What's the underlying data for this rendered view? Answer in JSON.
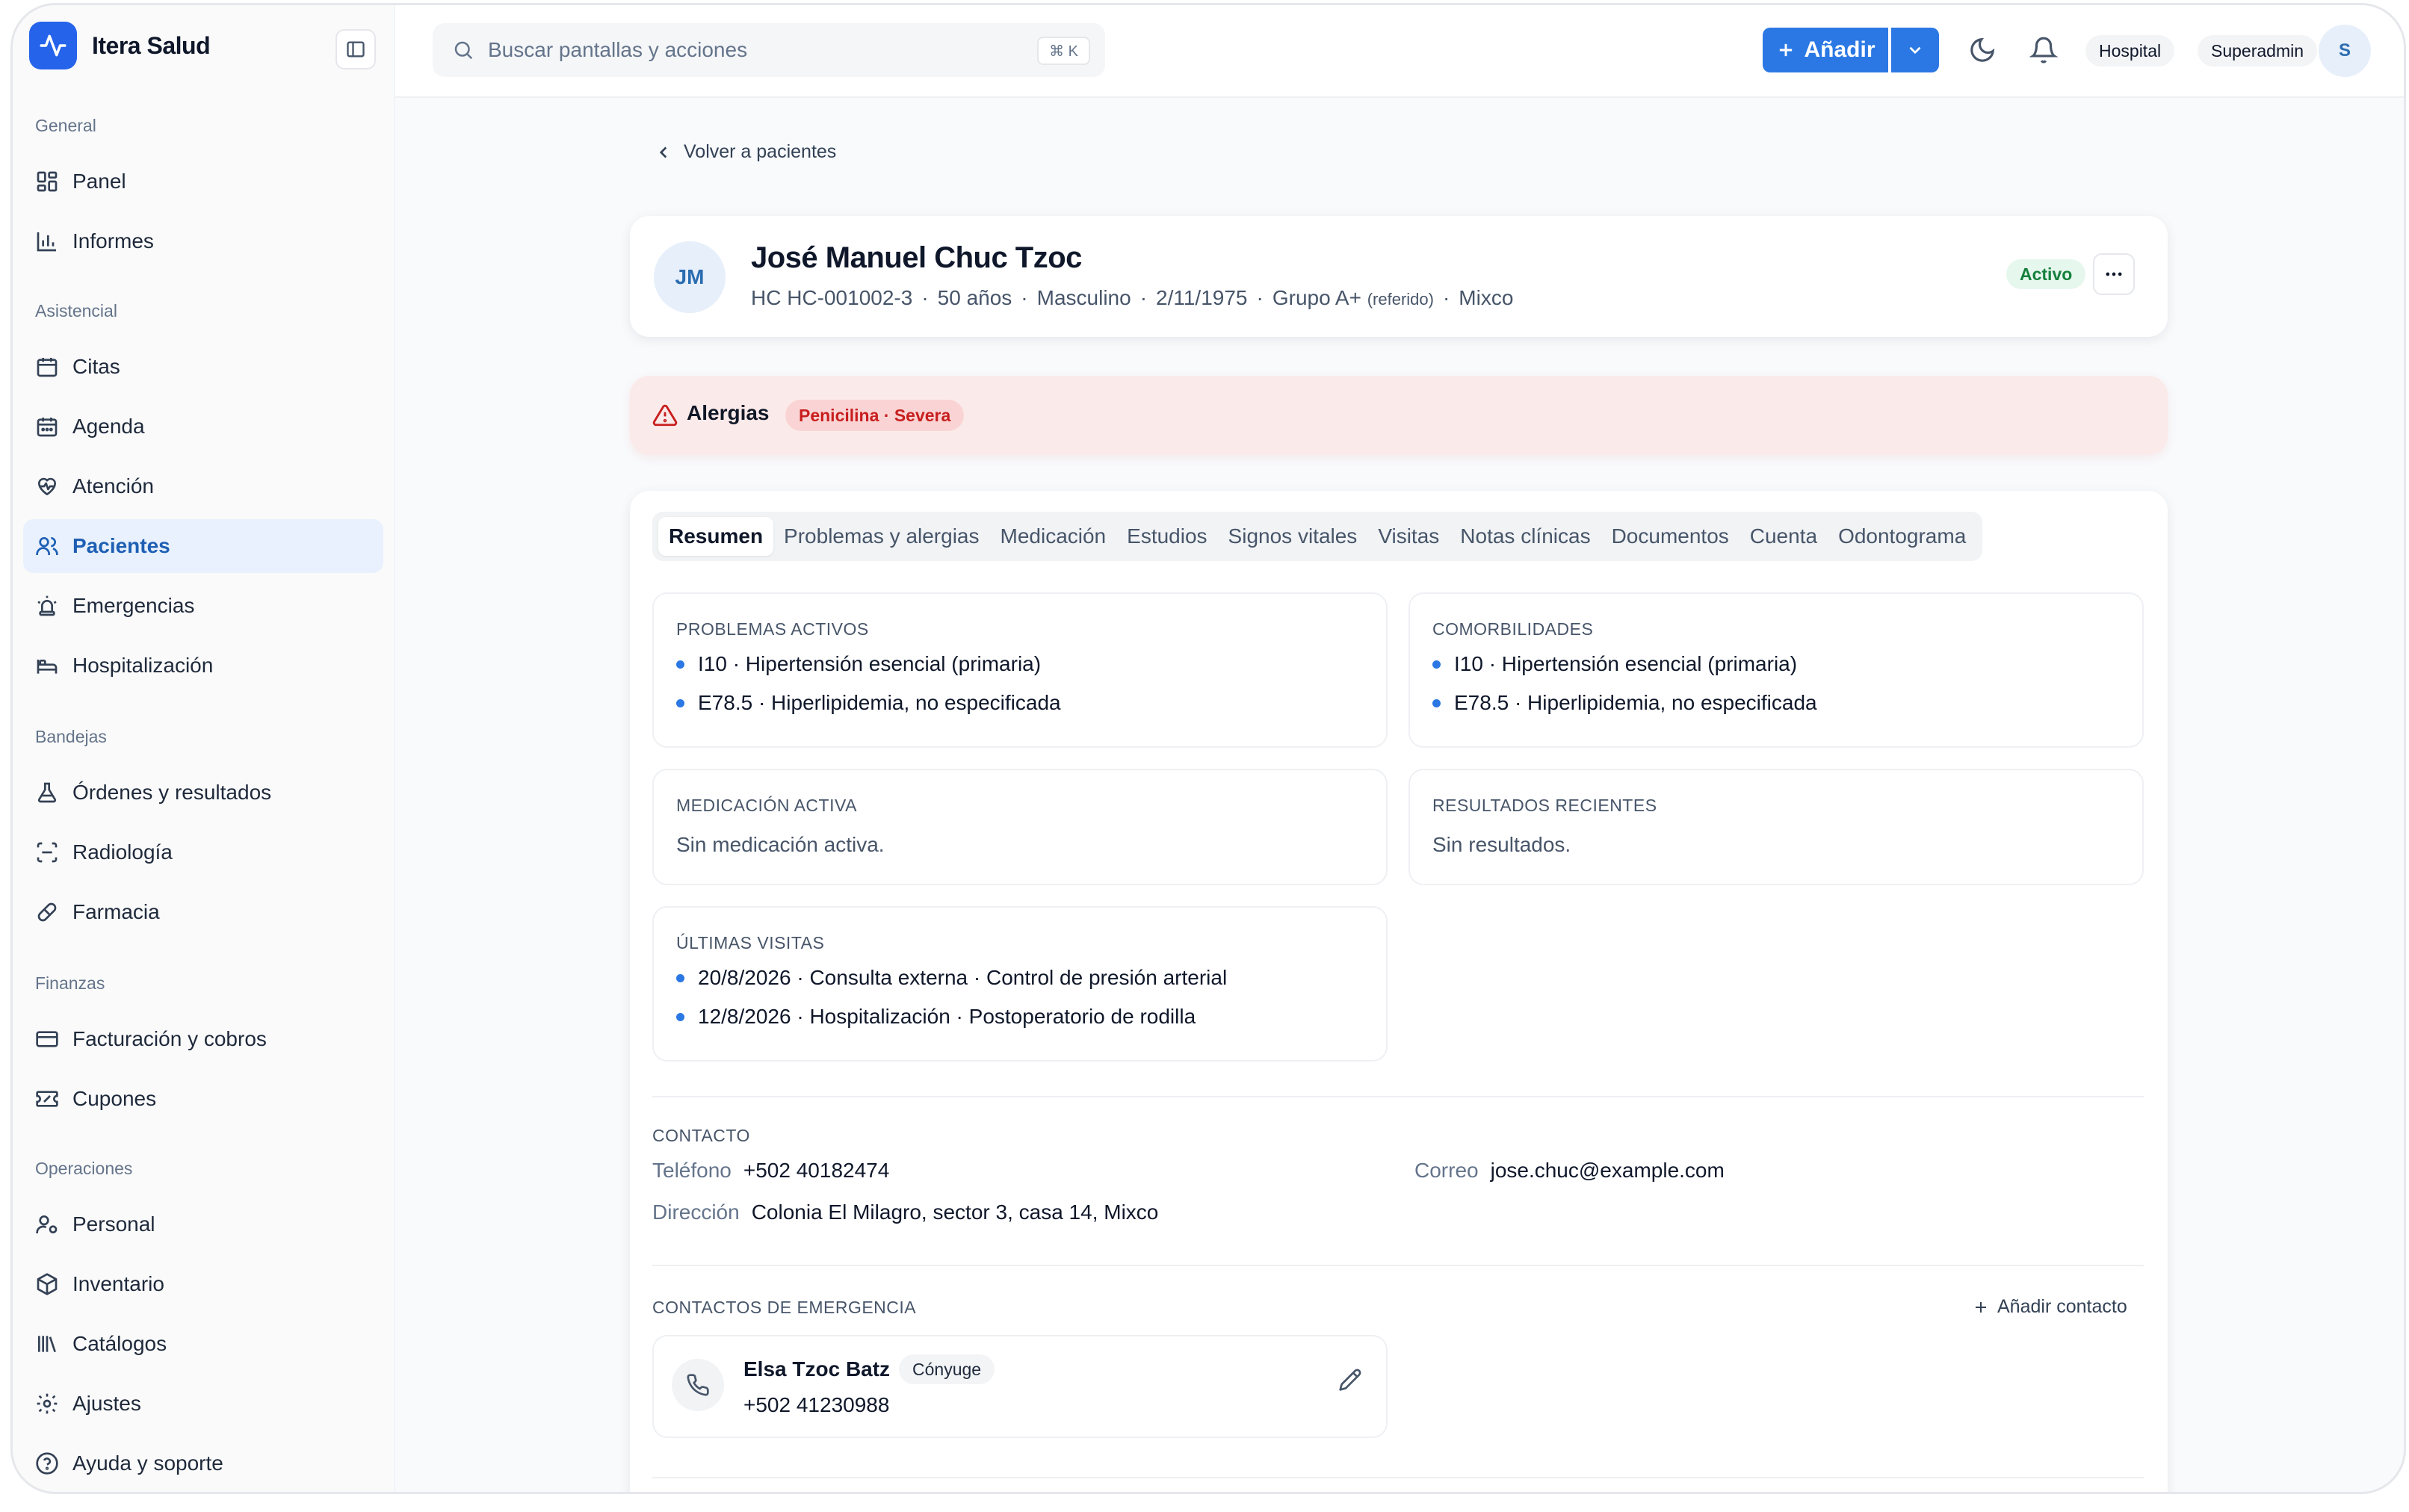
{
  "app": {
    "name": "Itera Salud"
  },
  "sidebar": {
    "sections": [
      {
        "label": "General"
      },
      {
        "label": "Asistencial"
      },
      {
        "label": "Bandejas"
      },
      {
        "label": "Finanzas"
      },
      {
        "label": "Operaciones"
      }
    ],
    "items": [
      {
        "label": "Panel",
        "icon": "grid-icon"
      },
      {
        "label": "Informes",
        "icon": "bar-chart-icon"
      },
      {
        "label": "Citas",
        "icon": "calendar-icon"
      },
      {
        "label": "Agenda",
        "icon": "calendar-grid-icon"
      },
      {
        "label": "Atención",
        "icon": "heart-pulse-icon"
      },
      {
        "label": "Pacientes",
        "icon": "users-icon",
        "active": true
      },
      {
        "label": "Emergencias",
        "icon": "siren-icon"
      },
      {
        "label": "Hospitalización",
        "icon": "bed-icon"
      },
      {
        "label": "Órdenes y resultados",
        "icon": "flask-icon"
      },
      {
        "label": "Radiología",
        "icon": "scan-icon"
      },
      {
        "label": "Farmacia",
        "icon": "pill-icon"
      },
      {
        "label": "Facturación y cobros",
        "icon": "credit-card-icon"
      },
      {
        "label": "Cupones",
        "icon": "ticket-icon"
      },
      {
        "label": "Personal",
        "icon": "user-cog-icon"
      },
      {
        "label": "Inventario",
        "icon": "package-icon"
      },
      {
        "label": "Catálogos",
        "icon": "library-icon"
      },
      {
        "label": "Ajustes",
        "icon": "gear-icon"
      },
      {
        "label": "Ayuda y soporte",
        "icon": "help-circle-icon"
      }
    ]
  },
  "topbar": {
    "search_placeholder": "Buscar pantallas y acciones",
    "shortcut": "⌘ K",
    "add_label": "Añadir",
    "org_pill": "Hospital",
    "role_pill": "Superadmin",
    "avatar_initial": "S"
  },
  "patient": {
    "back_label": "Volver a pacientes",
    "initials": "JM",
    "name": "José Manuel Chuc Tzoc",
    "record": "HC HC-001002-3",
    "age": "50 años",
    "sex": "Masculino",
    "dob": "2/11/1975",
    "blood": "Grupo A+",
    "blood_note": "(referido)",
    "city": "Mixco",
    "sep": "·",
    "status": "Activo"
  },
  "allergies": {
    "title": "Alergias",
    "badge": "Penicilina · Severa"
  },
  "tabs": [
    "Resumen",
    "Problemas y alergias",
    "Medicación",
    "Estudios",
    "Signos vitales",
    "Visitas",
    "Notas clínicas",
    "Documentos",
    "Cuenta",
    "Odontograma"
  ],
  "summary": {
    "problems": {
      "title": "PROBLEMAS ACTIVOS",
      "items": [
        "I10 · Hipertensión esencial (primaria)",
        "E78.5 · Hiperlipidemia, no especificada"
      ]
    },
    "comorbidities": {
      "title": "COMORBILIDADES",
      "items": [
        "I10 · Hipertensión esencial (primaria)",
        "E78.5 · Hiperlipidemia, no especificada"
      ]
    },
    "medication": {
      "title": "MEDICACIÓN ACTIVA",
      "empty": "Sin medicación activa."
    },
    "results": {
      "title": "RESULTADOS RECIENTES",
      "empty": "Sin resultados."
    },
    "visits": {
      "title": "ÚLTIMAS VISITAS",
      "items": [
        "20/8/2026 · Consulta externa · Control de presión arterial",
        "12/8/2026 · Hospitalización · Postoperatorio de rodilla"
      ]
    }
  },
  "contact": {
    "title": "CONTACTO",
    "phone_label": "Teléfono",
    "phone": "+502 40182474",
    "email_label": "Correo",
    "email": "jose.chuc@example.com",
    "address_label": "Dirección",
    "address": "Colonia El Milagro, sector 3, casa 14, Mixco"
  },
  "emergency": {
    "title": "CONTACTOS DE EMERGENCIA",
    "add_label": "Añadir contacto",
    "contacts": [
      {
        "name": "Elsa Tzoc Batz",
        "relation": "Cónyuge",
        "phone": "+502 41230988"
      }
    ]
  },
  "colors": {
    "accent": "#2b78e4",
    "active_nav_bg": "#e8f1fd",
    "allergy_bg": "#fbeaea",
    "status_green": "#15803d"
  }
}
